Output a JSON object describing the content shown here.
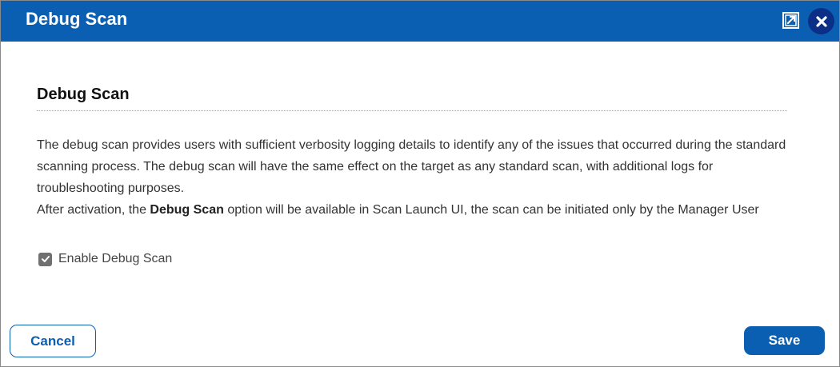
{
  "dialog": {
    "title": "Debug Scan",
    "icons": {
      "popout": "popout-icon",
      "close": "close-icon"
    },
    "colors": {
      "header": "#0a5fb3",
      "close_circle": "#0b2f87",
      "primary": "#0a5fb3"
    }
  },
  "content": {
    "section_title": "Debug Scan",
    "paragraph1_line1": "The debug scan provides users with sufficient verbosity logging details to identify any of the issues that occurred during the standard",
    "paragraph1_line2": "scanning process. The debug scan will have the same effect on the target as any standard scan, with additional logs for",
    "paragraph1_line3": "troubleshooting purposes.",
    "paragraph2_prefix": "After activation, the ",
    "paragraph2_bold": "Debug Scan",
    "paragraph2_suffix": " option will be available in Scan Launch UI, the scan can be initiated only by the Manager User"
  },
  "options": {
    "enable_debug_scan": {
      "label": "Enable Debug Scan",
      "checked": true
    }
  },
  "footer": {
    "cancel_label": "Cancel",
    "save_label": "Save"
  }
}
